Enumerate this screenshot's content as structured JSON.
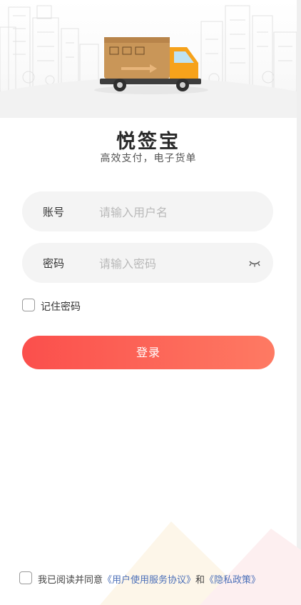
{
  "app": {
    "title": "悦签宝",
    "subtitle": "高效支付，电子货单"
  },
  "account": {
    "label": "账号",
    "placeholder": "请输入用户名"
  },
  "password": {
    "label": "密码",
    "placeholder": "请输入密码",
    "toggle_icon": "eye-closed-icon"
  },
  "remember": {
    "label": "记住密码",
    "checked": false
  },
  "login": {
    "label": "登录"
  },
  "agreement": {
    "prefix": "我已阅读并同意",
    "terms": "《用户使用服务协议》",
    "and": "和",
    "privacy": "《隐私政策》",
    "checked": false
  },
  "colors": {
    "accent": "#fb4f4c",
    "accent_end": "#fe7a63",
    "link": "#4b6fb8",
    "field_bg": "#f4f4f4"
  }
}
